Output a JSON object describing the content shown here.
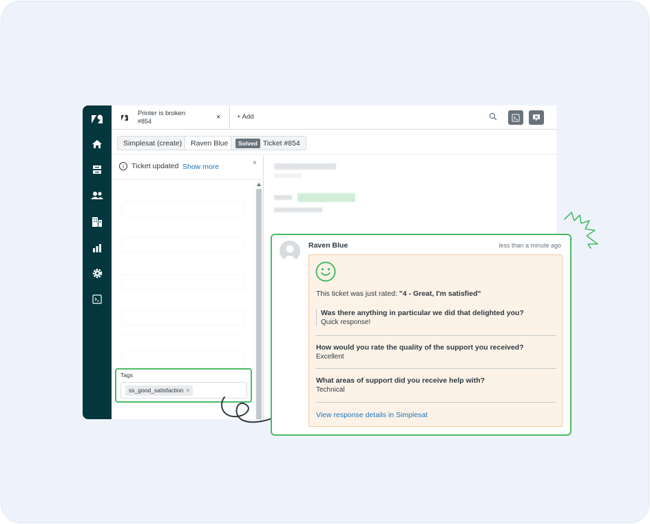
{
  "colors": {
    "nav_bg": "#03363d",
    "highlight": "#48bb65",
    "link": "#1f73b7",
    "response_bg": "#fdf2e8"
  },
  "topbar": {
    "tab_title": "Printer is broken",
    "tab_number": "#854",
    "tab_close": "×",
    "add_label": "+ Add"
  },
  "breadcrumbs": {
    "item1": "Simplesat (create)",
    "item2": "Raven Blue",
    "status": "Solved",
    "item3": "Ticket #854"
  },
  "notice": {
    "text": "Ticket updated",
    "link": "Show more",
    "close": "×"
  },
  "tags": {
    "label": "Tags",
    "value": "ss_good_satisfaction",
    "remove": "×"
  },
  "response": {
    "author": "Raven Blue",
    "time": "less than a minute ago",
    "rated_prefix": "This ticket was just rated: ",
    "rated_value": "\"4 - Great, I'm satisfied\"",
    "q1": "Was there anything in particular we did that delighted you?",
    "a1": "Quick response!",
    "q2": "How would you rate the quality of the support you received?",
    "a2": "Excellent",
    "q3": "What areas of support did you receive help with?",
    "a3": "Technical",
    "link": "View response details in Simplesat"
  }
}
